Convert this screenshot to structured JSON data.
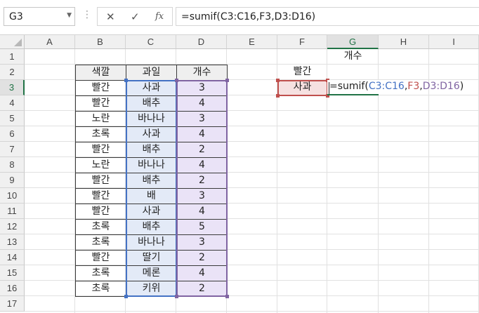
{
  "name_box": {
    "value": "G3"
  },
  "formula_bar": {
    "cancel_icon": "✕",
    "enter_icon": "✓",
    "fx_label": "fx",
    "value": "=sumif(C3:C16,F3,D3:D16)"
  },
  "columns": [
    "A",
    "B",
    "C",
    "D",
    "E",
    "F",
    "G",
    "H",
    "I"
  ],
  "rows": [
    "1",
    "2",
    "3",
    "4",
    "5",
    "6",
    "7",
    "8",
    "9",
    "10",
    "11",
    "12",
    "13",
    "14",
    "15",
    "16",
    "17"
  ],
  "active_cell": {
    "column": "G",
    "row": "3"
  },
  "table": {
    "headers": [
      "색깔",
      "과일",
      "개수"
    ],
    "rows": [
      [
        "빨간",
        "사과",
        "3"
      ],
      [
        "빨간",
        "배추",
        "4"
      ],
      [
        "노란",
        "바나나",
        "3"
      ],
      [
        "초록",
        "사과",
        "4"
      ],
      [
        "빨간",
        "배추",
        "2"
      ],
      [
        "노란",
        "바나나",
        "4"
      ],
      [
        "빨간",
        "배추",
        "2"
      ],
      [
        "빨간",
        "배",
        "3"
      ],
      [
        "빨간",
        "사과",
        "4"
      ],
      [
        "초록",
        "배추",
        "5"
      ],
      [
        "초록",
        "바나나",
        "3"
      ],
      [
        "빨간",
        "딸기",
        "2"
      ],
      [
        "초록",
        "메론",
        "4"
      ],
      [
        "초록",
        "키위",
        "2"
      ]
    ]
  },
  "criteria": {
    "g1": "개수",
    "f2": "빨간",
    "f3": "사과"
  },
  "editing_formula": {
    "prefix": "=sumif(",
    "ref1": "C3:C16",
    "sep1": ",",
    "ref2": "F3",
    "sep2": ",",
    "ref3": "D3:D16",
    "suffix": ")"
  },
  "colors": {
    "accent": "#217346",
    "ref1": "#4472c4",
    "ref2": "#c0504d",
    "ref3": "#8064a2"
  }
}
